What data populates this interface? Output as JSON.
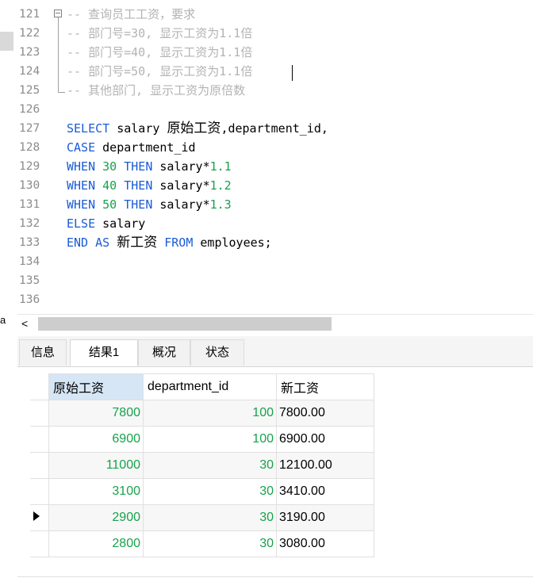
{
  "left_panel": {
    "cut_text": "a"
  },
  "editor": {
    "lines": [
      {
        "n": "121",
        "segs": [
          {
            "t": "-- 查询员工工资，要求",
            "c": "comment"
          }
        ]
      },
      {
        "n": "122",
        "segs": [
          {
            "t": "-- 部门号=30, 显示工资为1.1倍",
            "c": "comment"
          }
        ]
      },
      {
        "n": "123",
        "segs": [
          {
            "t": "-- 部门号=40, 显示工资为1.1倍",
            "c": "comment"
          }
        ]
      },
      {
        "n": "124",
        "segs": [
          {
            "t": "-- 部门号=50, 显示工资为1.1倍",
            "c": "comment"
          }
        ]
      },
      {
        "n": "125",
        "segs": [
          {
            "t": "-- 其他部门, 显示工资为原倍数",
            "c": "comment"
          }
        ]
      },
      {
        "n": "126",
        "segs": []
      },
      {
        "n": "127",
        "segs": [
          {
            "t": "SELECT",
            "c": "kw"
          },
          {
            "t": " salary ",
            "c": "id"
          },
          {
            "t": "原始工资",
            "c": "id cjk"
          },
          {
            "t": ",department_id,",
            "c": "id"
          }
        ]
      },
      {
        "n": "128",
        "segs": [
          {
            "t": "CASE",
            "c": "kw"
          },
          {
            "t": " department_id",
            "c": "id"
          }
        ]
      },
      {
        "n": "129",
        "segs": [
          {
            "t": "WHEN",
            "c": "kw"
          },
          {
            "t": " ",
            "c": "id"
          },
          {
            "t": "30",
            "c": "num"
          },
          {
            "t": " ",
            "c": "id"
          },
          {
            "t": "THEN",
            "c": "kw"
          },
          {
            "t": " salary*",
            "c": "id"
          },
          {
            "t": "1.1",
            "c": "num"
          }
        ]
      },
      {
        "n": "130",
        "segs": [
          {
            "t": "WHEN",
            "c": "kw"
          },
          {
            "t": " ",
            "c": "id"
          },
          {
            "t": "40",
            "c": "num"
          },
          {
            "t": " ",
            "c": "id"
          },
          {
            "t": "THEN",
            "c": "kw"
          },
          {
            "t": " salary*",
            "c": "id"
          },
          {
            "t": "1.2",
            "c": "num"
          }
        ]
      },
      {
        "n": "131",
        "segs": [
          {
            "t": "WHEN",
            "c": "kw"
          },
          {
            "t": " ",
            "c": "id"
          },
          {
            "t": "50",
            "c": "num"
          },
          {
            "t": " ",
            "c": "id"
          },
          {
            "t": "THEN",
            "c": "kw"
          },
          {
            "t": " salary*",
            "c": "id"
          },
          {
            "t": "1.3",
            "c": "num"
          }
        ]
      },
      {
        "n": "132",
        "segs": [
          {
            "t": "ELSE",
            "c": "kw"
          },
          {
            "t": " salary",
            "c": "id"
          }
        ]
      },
      {
        "n": "133",
        "segs": [
          {
            "t": "END",
            "c": "kw"
          },
          {
            "t": " ",
            "c": "id"
          },
          {
            "t": "AS",
            "c": "kw"
          },
          {
            "t": " ",
            "c": "id"
          },
          {
            "t": "新工资",
            "c": "id cjk"
          },
          {
            "t": " ",
            "c": "id"
          },
          {
            "t": "FROM",
            "c": "kw"
          },
          {
            "t": " employees;",
            "c": "id"
          }
        ]
      },
      {
        "n": "134",
        "segs": []
      },
      {
        "n": "135",
        "segs": []
      },
      {
        "n": "136",
        "segs": []
      }
    ]
  },
  "hscroll": {
    "arrow": "<"
  },
  "tabs": [
    {
      "label": "信息",
      "active": false
    },
    {
      "label": "结果1",
      "active": true
    },
    {
      "label": "概况",
      "active": false
    },
    {
      "label": "状态",
      "active": false
    }
  ],
  "result_grid": {
    "columns": [
      "原始工资",
      "department_id",
      "新工资"
    ],
    "rows": [
      [
        "7800",
        "100",
        "7800.00"
      ],
      [
        "6900",
        "100",
        "6900.00"
      ],
      [
        "11000",
        "30",
        "12100.00"
      ],
      [
        "3100",
        "30",
        "3410.00"
      ],
      [
        "2900",
        "30",
        "3190.00"
      ],
      [
        "2800",
        "30",
        "3080.00"
      ]
    ],
    "current_row": 4
  },
  "colors": {
    "keyword": "#1a5bd6",
    "number": "#16a34a",
    "comment": "#b3b3b3",
    "selected_header": "#d6e6f5"
  }
}
